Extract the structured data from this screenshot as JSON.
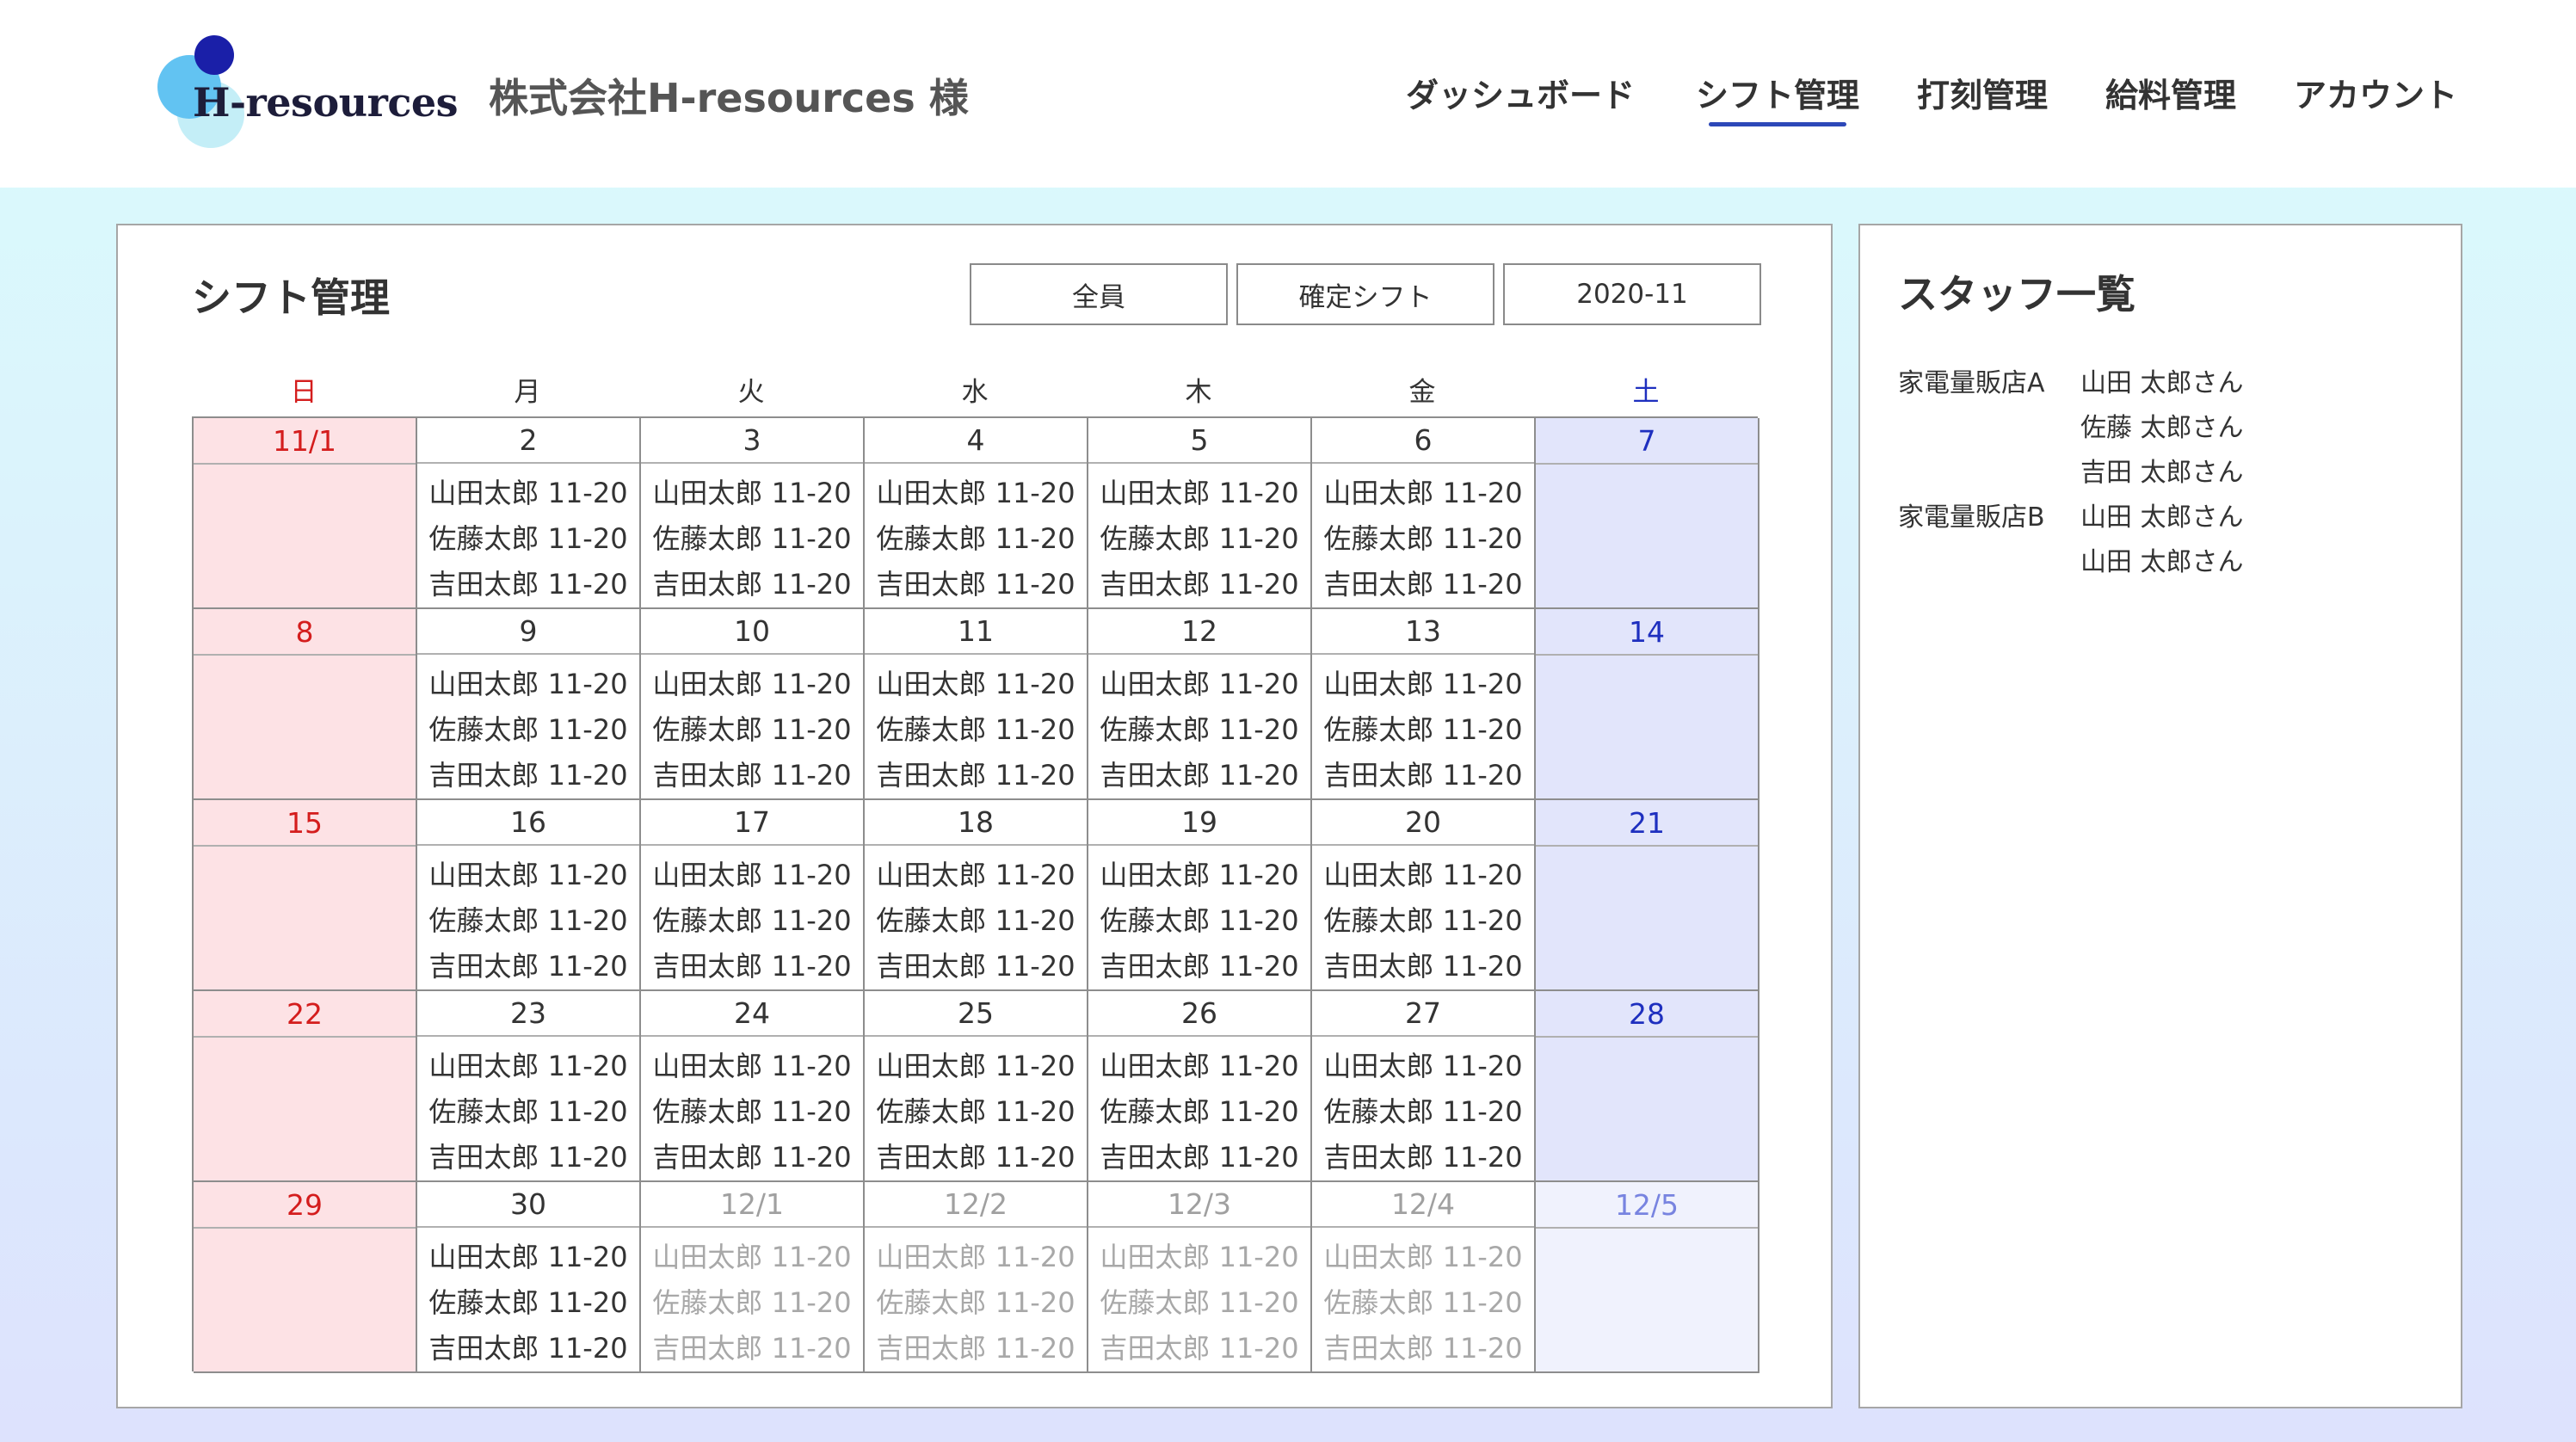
{
  "header": {
    "logo_text": "H-resources",
    "client_name": "株式会社H-resources 様",
    "nav": [
      {
        "label": "ダッシュボード",
        "active": false
      },
      {
        "label": "シフト管理",
        "active": true
      },
      {
        "label": "打刻管理",
        "active": false
      },
      {
        "label": "給料管理",
        "active": false
      },
      {
        "label": "アカウント",
        "active": false
      }
    ]
  },
  "main": {
    "title": "シフト管理",
    "filters": {
      "staff": "全員",
      "shift_type": "確定シフト",
      "month": "2020-11"
    },
    "weekdays": [
      "日",
      "月",
      "火",
      "水",
      "木",
      "金",
      "土"
    ],
    "weeks": [
      [
        {
          "date": "11/1",
          "shifts": []
        },
        {
          "date": "2",
          "shifts": [
            "山田太郎 11-20",
            "佐藤太郎 11-20",
            "吉田太郎 11-20"
          ]
        },
        {
          "date": "3",
          "shifts": [
            "山田太郎 11-20",
            "佐藤太郎 11-20",
            "吉田太郎 11-20"
          ]
        },
        {
          "date": "4",
          "shifts": [
            "山田太郎 11-20",
            "佐藤太郎 11-20",
            "吉田太郎 11-20"
          ]
        },
        {
          "date": "5",
          "shifts": [
            "山田太郎 11-20",
            "佐藤太郎 11-20",
            "吉田太郎 11-20"
          ]
        },
        {
          "date": "6",
          "shifts": [
            "山田太郎 11-20",
            "佐藤太郎 11-20",
            "吉田太郎 11-20"
          ]
        },
        {
          "date": "7",
          "shifts": []
        }
      ],
      [
        {
          "date": "8",
          "shifts": []
        },
        {
          "date": "9",
          "shifts": [
            "山田太郎 11-20",
            "佐藤太郎 11-20",
            "吉田太郎 11-20"
          ]
        },
        {
          "date": "10",
          "shifts": [
            "山田太郎 11-20",
            "佐藤太郎 11-20",
            "吉田太郎 11-20"
          ]
        },
        {
          "date": "11",
          "shifts": [
            "山田太郎 11-20",
            "佐藤太郎 11-20",
            "吉田太郎 11-20"
          ]
        },
        {
          "date": "12",
          "shifts": [
            "山田太郎 11-20",
            "佐藤太郎 11-20",
            "吉田太郎 11-20"
          ]
        },
        {
          "date": "13",
          "shifts": [
            "山田太郎 11-20",
            "佐藤太郎 11-20",
            "吉田太郎 11-20"
          ]
        },
        {
          "date": "14",
          "shifts": []
        }
      ],
      [
        {
          "date": "15",
          "shifts": []
        },
        {
          "date": "16",
          "shifts": [
            "山田太郎 11-20",
            "佐藤太郎 11-20",
            "吉田太郎 11-20"
          ]
        },
        {
          "date": "17",
          "shifts": [
            "山田太郎 11-20",
            "佐藤太郎 11-20",
            "吉田太郎 11-20"
          ]
        },
        {
          "date": "18",
          "shifts": [
            "山田太郎 11-20",
            "佐藤太郎 11-20",
            "吉田太郎 11-20"
          ]
        },
        {
          "date": "19",
          "shifts": [
            "山田太郎 11-20",
            "佐藤太郎 11-20",
            "吉田太郎 11-20"
          ]
        },
        {
          "date": "20",
          "shifts": [
            "山田太郎 11-20",
            "佐藤太郎 11-20",
            "吉田太郎 11-20"
          ]
        },
        {
          "date": "21",
          "shifts": []
        }
      ],
      [
        {
          "date": "22",
          "shifts": []
        },
        {
          "date": "23",
          "shifts": [
            "山田太郎 11-20",
            "佐藤太郎 11-20",
            "吉田太郎 11-20"
          ]
        },
        {
          "date": "24",
          "shifts": [
            "山田太郎 11-20",
            "佐藤太郎 11-20",
            "吉田太郎 11-20"
          ]
        },
        {
          "date": "25",
          "shifts": [
            "山田太郎 11-20",
            "佐藤太郎 11-20",
            "吉田太郎 11-20"
          ]
        },
        {
          "date": "26",
          "shifts": [
            "山田太郎 11-20",
            "佐藤太郎 11-20",
            "吉田太郎 11-20"
          ]
        },
        {
          "date": "27",
          "shifts": [
            "山田太郎 11-20",
            "佐藤太郎 11-20",
            "吉田太郎 11-20"
          ]
        },
        {
          "date": "28",
          "shifts": []
        }
      ],
      [
        {
          "date": "29",
          "shifts": []
        },
        {
          "date": "30",
          "shifts": [
            "山田太郎 11-20",
            "佐藤太郎 11-20",
            "吉田太郎 11-20"
          ]
        },
        {
          "date": "12/1",
          "shifts": [
            "山田太郎 11-20",
            "佐藤太郎 11-20",
            "吉田太郎 11-20"
          ],
          "next_month": true
        },
        {
          "date": "12/2",
          "shifts": [
            "山田太郎 11-20",
            "佐藤太郎 11-20",
            "吉田太郎 11-20"
          ],
          "next_month": true
        },
        {
          "date": "12/3",
          "shifts": [
            "山田太郎 11-20",
            "佐藤太郎 11-20",
            "吉田太郎 11-20"
          ],
          "next_month": true
        },
        {
          "date": "12/4",
          "shifts": [
            "山田太郎 11-20",
            "佐藤太郎 11-20",
            "吉田太郎 11-20"
          ],
          "next_month": true
        },
        {
          "date": "12/5",
          "shifts": [],
          "next_month": true
        }
      ]
    ]
  },
  "staff": {
    "title": "スタッフ一覧",
    "groups": [
      {
        "store": "家電量販店A",
        "members": [
          "山田 太郎さん",
          "佐藤 太郎さん",
          "吉田 太郎さん"
        ]
      },
      {
        "store": "家電量販店B",
        "members": [
          "山田 太郎さん",
          "山田 太郎さん"
        ]
      }
    ]
  },
  "colors": {
    "sunday_text": "#d41d1d",
    "saturday_text": "#1e2fbf",
    "sunday_bg": "#fde2e5",
    "saturday_bg": "#e2e5fb",
    "nav_underline": "#2d48b8",
    "logo_dark": "#1a1fa8",
    "logo_sky": "#62c3f2"
  }
}
